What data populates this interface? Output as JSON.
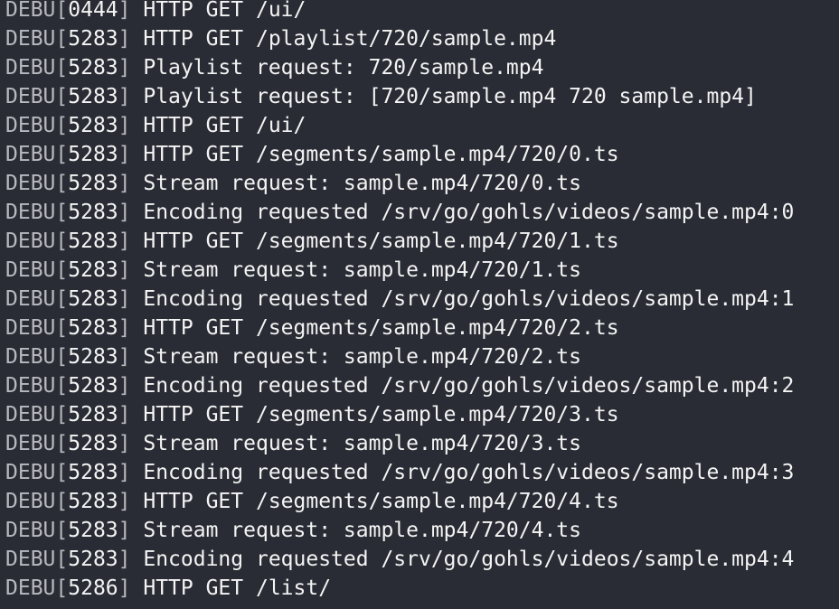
{
  "terminal": {
    "colors": {
      "background": "#2a2c35",
      "level_text": "#b8b9bf",
      "message_text": "#f4f4f4"
    },
    "lines": [
      {
        "level": "DEBU",
        "pid": "0444",
        "message": "HTTP GET /ui/"
      },
      {
        "level": "DEBU",
        "pid": "5283",
        "message": "HTTP GET /playlist/720/sample.mp4"
      },
      {
        "level": "DEBU",
        "pid": "5283",
        "message": "Playlist request: 720/sample.mp4"
      },
      {
        "level": "DEBU",
        "pid": "5283",
        "message": "Playlist request: [720/sample.mp4 720 sample.mp4]"
      },
      {
        "level": "DEBU",
        "pid": "5283",
        "message": "HTTP GET /ui/"
      },
      {
        "level": "DEBU",
        "pid": "5283",
        "message": "HTTP GET /segments/sample.mp4/720/0.ts"
      },
      {
        "level": "DEBU",
        "pid": "5283",
        "message": "Stream request: sample.mp4/720/0.ts"
      },
      {
        "level": "DEBU",
        "pid": "5283",
        "message": "Encoding requested /srv/go/gohls/videos/sample.mp4:0"
      },
      {
        "level": "DEBU",
        "pid": "5283",
        "message": "HTTP GET /segments/sample.mp4/720/1.ts"
      },
      {
        "level": "DEBU",
        "pid": "5283",
        "message": "Stream request: sample.mp4/720/1.ts"
      },
      {
        "level": "DEBU",
        "pid": "5283",
        "message": "Encoding requested /srv/go/gohls/videos/sample.mp4:1"
      },
      {
        "level": "DEBU",
        "pid": "5283",
        "message": "HTTP GET /segments/sample.mp4/720/2.ts"
      },
      {
        "level": "DEBU",
        "pid": "5283",
        "message": "Stream request: sample.mp4/720/2.ts"
      },
      {
        "level": "DEBU",
        "pid": "5283",
        "message": "Encoding requested /srv/go/gohls/videos/sample.mp4:2"
      },
      {
        "level": "DEBU",
        "pid": "5283",
        "message": "HTTP GET /segments/sample.mp4/720/3.ts"
      },
      {
        "level": "DEBU",
        "pid": "5283",
        "message": "Stream request: sample.mp4/720/3.ts"
      },
      {
        "level": "DEBU",
        "pid": "5283",
        "message": "Encoding requested /srv/go/gohls/videos/sample.mp4:3"
      },
      {
        "level": "DEBU",
        "pid": "5283",
        "message": "HTTP GET /segments/sample.mp4/720/4.ts"
      },
      {
        "level": "DEBU",
        "pid": "5283",
        "message": "Stream request: sample.mp4/720/4.ts"
      },
      {
        "level": "DEBU",
        "pid": "5283",
        "message": "Encoding requested /srv/go/gohls/videos/sample.mp4:4"
      },
      {
        "level": "DEBU",
        "pid": "5286",
        "message": "HTTP GET /list/"
      }
    ]
  }
}
